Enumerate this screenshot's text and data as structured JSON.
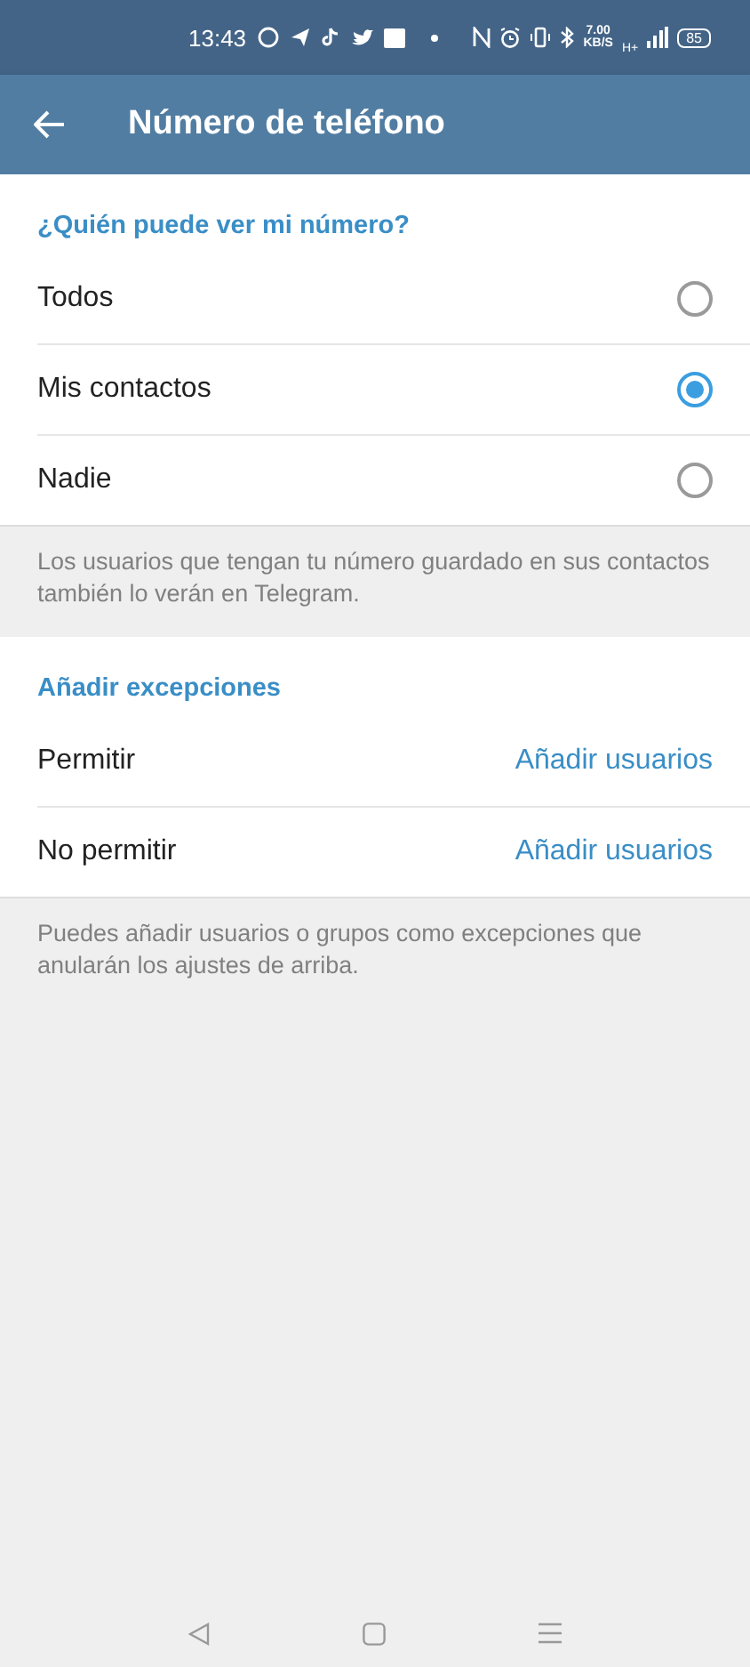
{
  "status_bar": {
    "time": "13:43",
    "speed_value": "7.00",
    "speed_unit": "KB/S",
    "network": "H+",
    "battery": "85"
  },
  "header": {
    "title": "Número de teléfono"
  },
  "visibility": {
    "heading": "¿Quién puede ver mi número?",
    "options": [
      {
        "label": "Todos",
        "selected": false
      },
      {
        "label": "Mis contactos",
        "selected": true
      },
      {
        "label": "Nadie",
        "selected": false
      }
    ],
    "note": "Los usuarios que tengan tu número guardado en sus contactos también lo verán en Telegram."
  },
  "exceptions": {
    "heading": "Añadir excepciones",
    "rows": [
      {
        "label": "Permitir",
        "action": "Añadir usuarios"
      },
      {
        "label": "No permitir",
        "action": "Añadir usuarios"
      }
    ],
    "note": "Puedes añadir usuarios o grupos como excepciones que anularán los ajustes de arriba."
  }
}
